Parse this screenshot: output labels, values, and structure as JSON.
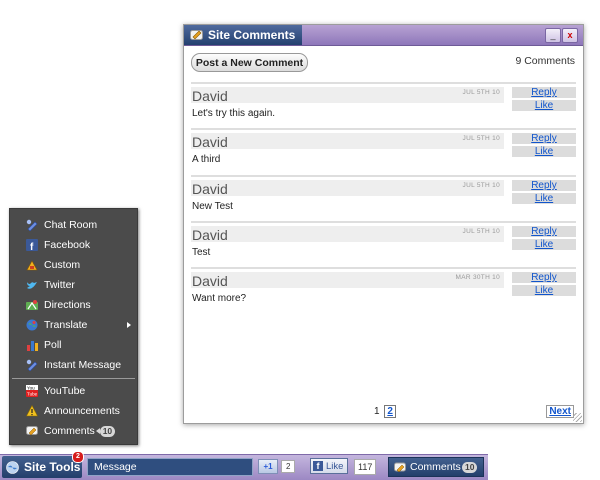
{
  "comments_window": {
    "title": "Site Comments",
    "minimize_label": "_",
    "close_label": "x",
    "post_button": "Post a New Comment",
    "count_text": "9 Comments",
    "reply_label": "Reply",
    "like_label": "Like",
    "comments": [
      {
        "author": "David",
        "date": "JUL 5TH 10",
        "text": "Let's try this again."
      },
      {
        "author": "David",
        "date": "JUL 5TH 10",
        "text": "A third"
      },
      {
        "author": "David",
        "date": "JUL 5TH 10",
        "text": "New Test"
      },
      {
        "author": "David",
        "date": "JUL 5TH 10",
        "text": "Test"
      },
      {
        "author": "David",
        "date": "MAR 30TH 10",
        "text": "Want more?"
      }
    ],
    "pagination": {
      "current": "1",
      "next_page": "2",
      "next_label": "Next"
    }
  },
  "tools_menu": {
    "items": [
      {
        "label": "Chat Room",
        "icon": "chat-icon"
      },
      {
        "label": "Facebook",
        "icon": "facebook-icon"
      },
      {
        "label": "Custom",
        "icon": "custom-icon"
      },
      {
        "label": "Twitter",
        "icon": "twitter-icon"
      },
      {
        "label": "Directions",
        "icon": "directions-icon"
      },
      {
        "label": "Translate",
        "icon": "translate-icon"
      },
      {
        "label": "Poll",
        "icon": "poll-icon"
      },
      {
        "label": "Instant Message",
        "icon": "instant-message-icon"
      },
      {
        "label": "YouTube",
        "icon": "youtube-icon"
      },
      {
        "label": "Announcements",
        "icon": "announcements-icon"
      },
      {
        "label": "Comments",
        "icon": "comments-icon",
        "badge": "10"
      }
    ]
  },
  "toolbar": {
    "site_tools_label": "Site Tools",
    "notification_count": "2",
    "message_placeholder": "Message",
    "gplus_label": "+1",
    "gplus_count": "2",
    "fb_label": "Like",
    "fb_count": "117",
    "comments_label": "Comments",
    "comments_count": "10"
  },
  "colors": {
    "toolbar_purple": "#9c88c3",
    "navy": "#233f6b",
    "menu_bg": "#4b4b4b",
    "link_blue": "#1155cc"
  }
}
